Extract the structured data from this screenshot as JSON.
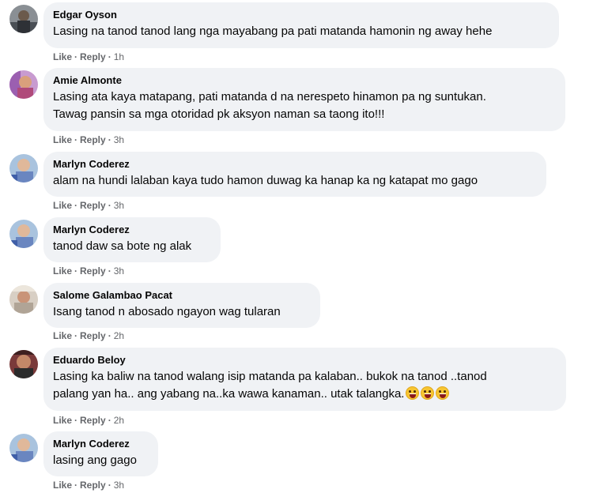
{
  "comments": [
    {
      "author": "Edgar Oyson",
      "text": "Lasing na tanod tanod lang nga mayabang pa pati matanda hamonin ng away hehe",
      "like": "Like",
      "reply": "Reply",
      "time": "1h"
    },
    {
      "author": "Amie Almonte",
      "text": "Lasing ata kaya matapang, pati matanda d na nerespeto hinamon pa ng suntukan.\nTawag pansin sa mga otoridad pk aksyon naman sa taong ito!!!",
      "like": "Like",
      "reply": "Reply",
      "time": "3h"
    },
    {
      "author": "Marlyn Coderez",
      "text": "alam na hundi lalaban kaya tudo hamon duwag ka hanap ka ng katapat mo gago",
      "like": "Like",
      "reply": "Reply",
      "time": "3h"
    },
    {
      "author": "Marlyn Coderez",
      "text": "tanod daw sa bote ng alak",
      "like": "Like",
      "reply": "Reply",
      "time": "3h"
    },
    {
      "author": "Salome Galambao Pacat",
      "text": "Isang tanod n abosado ngayon wag tularan",
      "like": "Like",
      "reply": "Reply",
      "time": "2h"
    },
    {
      "author": "Eduardo Beloy",
      "text": "Lasing ka baliw na tanod walang isip matanda pa kalaban.. bukok na tanod ..tanod\npalang yan ha.. ang yabang na..ka wawa kanaman.. utak talangka.",
      "emoji": "crazy-face-icon",
      "like": "Like",
      "reply": "Reply",
      "time": "2h"
    },
    {
      "author": "Marlyn Coderez",
      "text": "lasing ang gago",
      "like": "Like",
      "reply": "Reply",
      "time": "3h"
    }
  ],
  "separator": "·",
  "colors": {
    "bubble": "#f0f2f5",
    "meta": "#65676b",
    "text": "#050505"
  }
}
